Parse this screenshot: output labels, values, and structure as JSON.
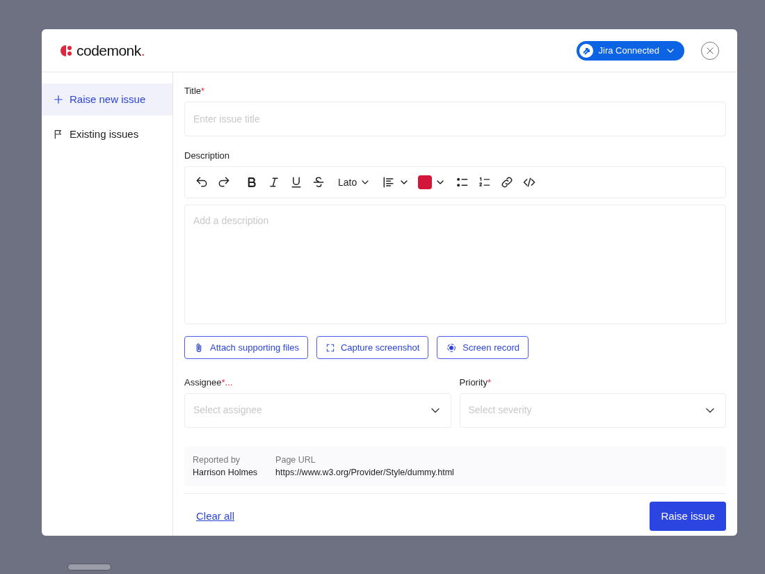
{
  "header": {
    "logo": "codemonk",
    "logo_dot": ".",
    "integration": {
      "label": "Jira Connected"
    }
  },
  "sidebar": {
    "items": [
      {
        "label": "Raise new issue",
        "kind": "plus",
        "selected": true
      },
      {
        "label": "Existing issues",
        "kind": "flag",
        "selected": false
      }
    ]
  },
  "title_field": {
    "label": "Title",
    "required_mark": "*",
    "placeholder": "Enter issue title"
  },
  "description": {
    "label": "Description",
    "placeholder": "Add a description",
    "toolbar": [
      {
        "kind": "undo"
      },
      {
        "kind": "redo"
      },
      {
        "kind": "gap"
      },
      {
        "kind": "bold"
      },
      {
        "kind": "italic"
      },
      {
        "kind": "underline"
      },
      {
        "kind": "strike"
      },
      {
        "kind": "font",
        "label": "Lato"
      },
      {
        "kind": "align"
      },
      {
        "kind": "color",
        "color": "#d3173a"
      },
      {
        "kind": "bullets"
      },
      {
        "kind": "numbers"
      },
      {
        "kind": "link"
      },
      {
        "kind": "code"
      }
    ]
  },
  "attachments": [
    {
      "kind": "clip",
      "label": "Attach supporting files"
    },
    {
      "kind": "capture",
      "label": "Capture screenshot"
    },
    {
      "kind": "record",
      "label": "Screen record"
    }
  ],
  "selects": [
    {
      "label": "Assignee",
      "required_mark": "*...",
      "placeholder": "Select assignee"
    },
    {
      "label": "Priority",
      "required_mark": "*",
      "placeholder": "Select severity"
    }
  ],
  "meta": [
    {
      "label": "Reported by",
      "value": "Harrison Holmes"
    },
    {
      "label": "Page URL",
      "value": "https://www.w3.org/Provider/Style/dummy.html"
    }
  ],
  "footer": {
    "link": "Clear all",
    "button": "Raise issue"
  }
}
